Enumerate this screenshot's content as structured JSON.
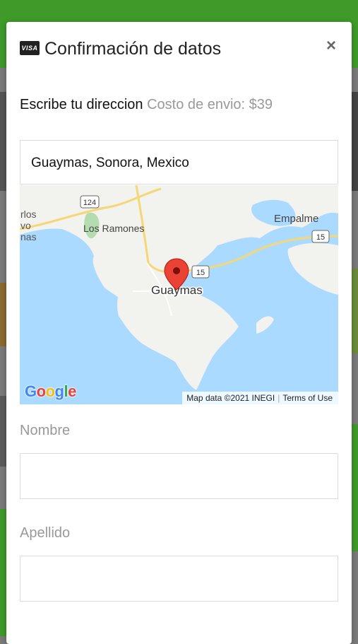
{
  "modal": {
    "title": "Confirmación de datos",
    "card_icon": "visa-card-icon",
    "card_icon_text": "VISA",
    "close_icon": "close-icon",
    "close_label": "×"
  },
  "address": {
    "label": "Escribe tu direccion",
    "shipping_cost": "Costo de envio: $39",
    "value": "Guaymas, Sonora, Mexico"
  },
  "map": {
    "places": [
      "Guaymas",
      "Los Ramones",
      "Empalme",
      "rlos",
      "vo",
      "nas"
    ],
    "highways": [
      "124",
      "15",
      "15"
    ],
    "attribution": "Map data ©2021 INEGI",
    "terms": "Terms of Use",
    "logo": "Google",
    "water_color": "#aadaff",
    "land_color": "#f2f2ee",
    "marker_color": "#ea4335"
  },
  "form": {
    "first_name_label": "Nombre",
    "last_name_label": "Apellido",
    "first_name_value": "",
    "last_name_value": ""
  },
  "colors": {
    "brand_green": "#3f9a2a"
  }
}
